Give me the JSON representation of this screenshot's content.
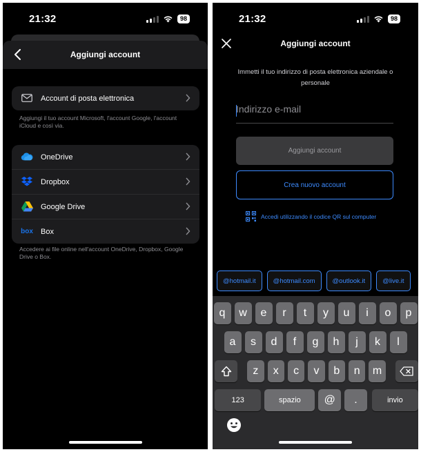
{
  "left": {
    "status": {
      "time": "21:32",
      "battery": "98"
    },
    "nav": {
      "title": "Aggiungi account"
    },
    "email_row": {
      "label": "Account di posta elettronica"
    },
    "email_note": "Aggiungi il tuo account Microsoft, l'account Google, l'account iCloud e così via.",
    "storage_rows": [
      {
        "label": "OneDrive",
        "icon": "onedrive-icon"
      },
      {
        "label": "Dropbox",
        "icon": "dropbox-icon"
      },
      {
        "label": "Google Drive",
        "icon": "google-drive-icon"
      },
      {
        "label": "Box",
        "icon": "box-icon"
      }
    ],
    "storage_note": "Accedere ai file online nell'account OneDrive, Dropbox, Google Drive o Box."
  },
  "right": {
    "status": {
      "time": "21:32",
      "battery": "98"
    },
    "nav": {
      "title": "Aggiungi account"
    },
    "intro": "Immetti il tuo indirizzo di posta elettronica aziendale o personale",
    "email_input": {
      "placeholder": "Indirizzo e-mail",
      "value": ""
    },
    "add_button": "Aggiungi account",
    "create_button": "Crea nuovo account",
    "qr_link": "Accedi utilizzando il codice QR sul computer",
    "suggestions": [
      "@hotmail.it",
      "@hotmail.com",
      "@outlook.it",
      "@live.it"
    ],
    "keyboard": {
      "row1": [
        "q",
        "w",
        "e",
        "r",
        "t",
        "y",
        "u",
        "i",
        "o",
        "p"
      ],
      "row2": [
        "a",
        "s",
        "d",
        "f",
        "g",
        "h",
        "j",
        "k",
        "l"
      ],
      "row3": [
        "z",
        "x",
        "c",
        "v",
        "b",
        "n",
        "m"
      ],
      "numbers": "123",
      "space": "spazio",
      "at": "@",
      "dot": ".",
      "return": "invio"
    }
  },
  "colors": {
    "accent": "#3d8bff",
    "card": "#1c1c1e",
    "background": "#000000"
  }
}
